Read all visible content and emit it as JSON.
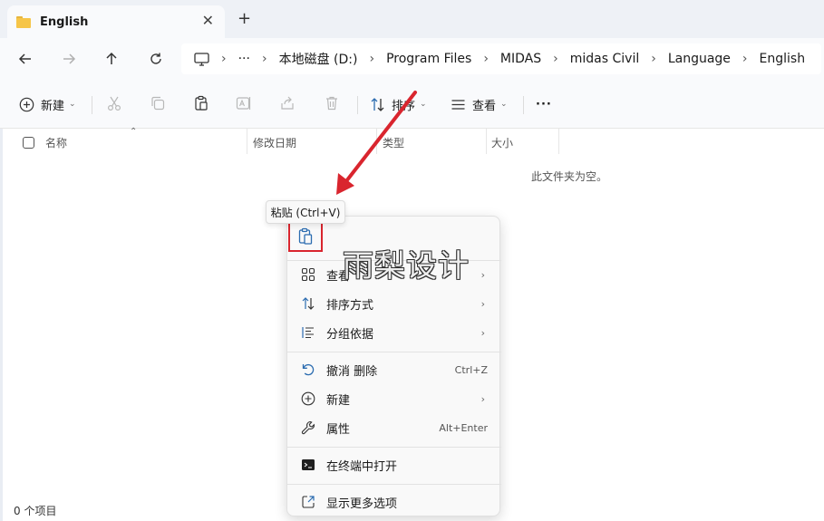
{
  "window": {
    "tab_title": "English",
    "new_tab_glyph": "+",
    "close_glyph": "✕"
  },
  "breadcrumbs": {
    "overflow_glyph": "···",
    "items": [
      "本地磁盘 (D:)",
      "Program Files",
      "MIDAS",
      "midas Civil",
      "Language",
      "English"
    ]
  },
  "toolbar": {
    "new_label": "新建",
    "sort_label": "排序",
    "view_label": "查看",
    "more_glyph": "···"
  },
  "columns": {
    "name": "名称",
    "modified": "修改日期",
    "type": "类型",
    "size": "大小"
  },
  "file_list": {
    "empty_message": "此文件夹为空。"
  },
  "status_bar": {
    "item_count": "0 个项目"
  },
  "context_menu": {
    "tooltip": "粘贴 (Ctrl+V)",
    "items": [
      {
        "label": "查看",
        "shortcut": "",
        "submenu": true
      },
      {
        "label": "排序方式",
        "shortcut": "",
        "submenu": true
      },
      {
        "label": "分组依据",
        "shortcut": "",
        "submenu": true
      },
      {
        "label": "撤消 删除",
        "shortcut": "Ctrl+Z",
        "submenu": false
      },
      {
        "label": "新建",
        "shortcut": "",
        "submenu": true
      },
      {
        "label": "属性",
        "shortcut": "Alt+Enter",
        "submenu": false
      },
      {
        "label": "在终端中打开",
        "shortcut": "",
        "submenu": false
      },
      {
        "label": "显示更多选项",
        "shortcut": "",
        "submenu": false
      }
    ],
    "submenu_glyph": "›"
  },
  "watermark": "雨梨设计",
  "colors": {
    "highlight_red": "#d9252e",
    "folder_yellow": "#f6c548",
    "accent_blue": "#2b6cb0"
  }
}
